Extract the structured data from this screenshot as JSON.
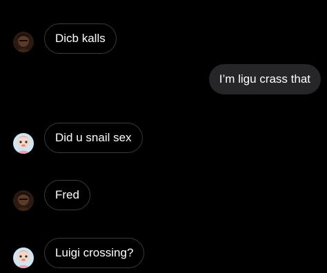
{
  "conversation": {
    "messages": [
      {
        "direction": "incoming",
        "sender_avatar": "dark-portrait-avatar",
        "text": "Dicb kalls"
      },
      {
        "direction": "outgoing",
        "text": "I’m ligu crass that"
      },
      {
        "direction": "incoming",
        "sender_avatar": "cartoon-character-avatar",
        "text": "Did u snail sex"
      },
      {
        "direction": "incoming",
        "sender_avatar": "dark-portrait-avatar",
        "text": "Fred"
      },
      {
        "direction": "incoming",
        "sender_avatar": "cartoon-character-avatar",
        "text": "Luigi crossing?"
      }
    ]
  },
  "colors": {
    "background": "#000000",
    "incoming_border": "#3a3a3c",
    "outgoing_fill": "#262628",
    "text": "#ffffff"
  }
}
